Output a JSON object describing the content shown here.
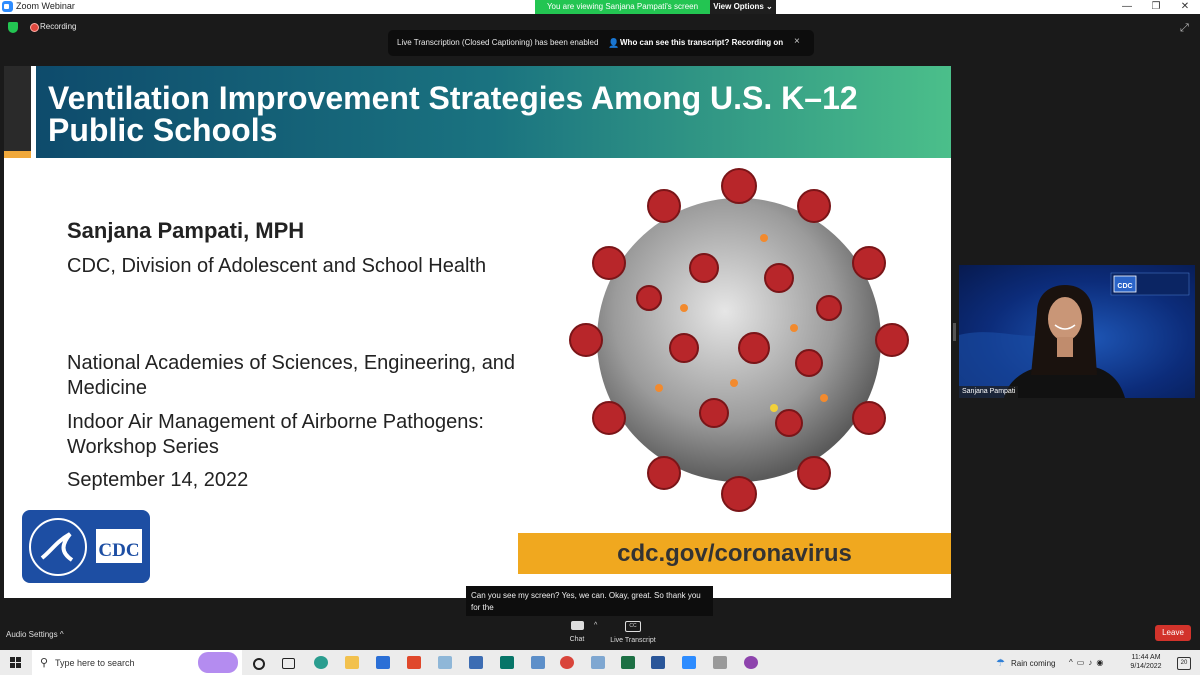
{
  "window": {
    "title": "Zoom Webinar",
    "viewing_banner": "You are viewing Sanjana Pampati's screen",
    "view_options": "View Options",
    "view_options_chevron": "⌄",
    "minimize": "—",
    "maximize": "❐",
    "close": "✕"
  },
  "meeting": {
    "recording_label": "Recording",
    "fullscreen_icon": "⤢",
    "transcription_banner": {
      "message": "Live Transcription (Closed Captioning) has been enabled",
      "who_icon": "👤",
      "who_link": "Who can see this transcript? Recording on",
      "close": "×"
    }
  },
  "slide": {
    "title": "Ventilation Improvement Strategies Among U.S. K–12 Public Schools",
    "author": "Sanjana Pampati, MPH",
    "affiliation": "CDC, Division of Adolescent and School Health",
    "org_line": "National Academies of Sciences, Engineering, and Medicine",
    "workshop_line": "Indoor Air Management of Airborne Pathogens: Workshop Series",
    "date": "September 14, 2022",
    "url": "cdc.gov/coronavirus",
    "logo_text": "CDC",
    "colors": {
      "header_start": "#0e4b6c",
      "header_end": "#4bbf8a",
      "accent": "#f0a81f"
    }
  },
  "caption": {
    "text": "Can you see my screen? Yes, we can. Okay, great. So thank you for the"
  },
  "video_tile": {
    "participant_name": "Sanjana Pampati",
    "logo_text": "CDC"
  },
  "controls": {
    "audio_settings": "Audio Settings",
    "audio_chevron": "^",
    "chat": "Chat",
    "live_transcript": "Live Transcript",
    "cc_icon_text": "CC",
    "more_chevron": "^",
    "leave": "Leave"
  },
  "taskbar": {
    "search_placeholder": "Type here to search",
    "weather": "Rain coming",
    "time": "11:44 AM",
    "date": "9/14/2022",
    "notifications": "20"
  }
}
